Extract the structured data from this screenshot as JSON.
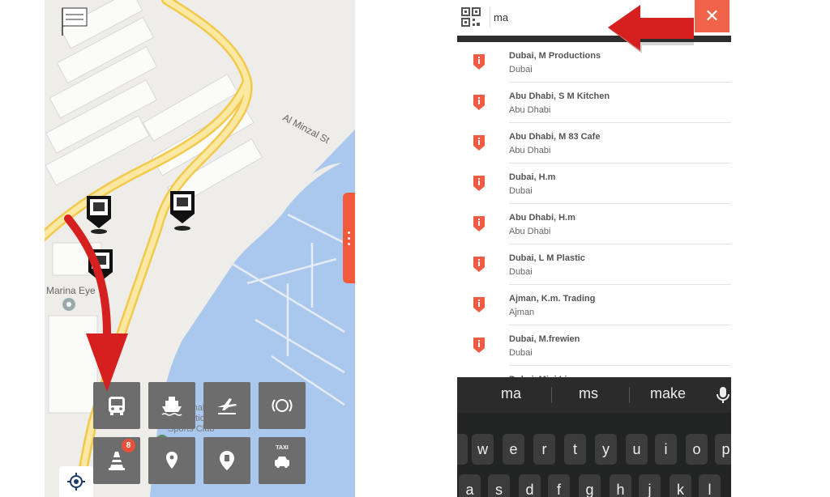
{
  "map": {
    "labels": {
      "street": "Al Minzal St",
      "marina_eye": "Marina Eye",
      "sports_club": "Abu Dhabi International Marine Sports Club"
    },
    "grid_buttons": [
      {
        "name": "bus-button",
        "icon": "bus-icon"
      },
      {
        "name": "ferry-button",
        "icon": "ferry-icon"
      },
      {
        "name": "airport-button",
        "icon": "airplane-icon"
      },
      {
        "name": "parking-button",
        "icon": "parking-signal-icon"
      },
      {
        "name": "road-works-button",
        "icon": "traffic-cone-icon",
        "badge": "8"
      },
      {
        "name": "place-pin-button",
        "icon": "location-pin-icon"
      },
      {
        "name": "fuel-pin-button",
        "icon": "fuel-pin-icon"
      },
      {
        "name": "taxi-button",
        "icon": "taxi-icon",
        "label": "TAXI"
      }
    ]
  },
  "search": {
    "query": "ma",
    "clear_label": "✕",
    "results": [
      {
        "title": "Dubai, M Productions",
        "subtitle": "Dubai"
      },
      {
        "title": "Abu Dhabi, S M Kitchen",
        "subtitle": "Abu Dhabi"
      },
      {
        "title": "Abu Dhabi, M 83 Cafe",
        "subtitle": "Abu Dhabi"
      },
      {
        "title": "Dubai, H.m",
        "subtitle": "Dubai"
      },
      {
        "title": "Abu Dhabi, H.m",
        "subtitle": "Abu Dhabi"
      },
      {
        "title": "Dubai, L M Plastic",
        "subtitle": "Dubai"
      },
      {
        "title": "Ajman, K.m. Trading",
        "subtitle": "Ajman"
      },
      {
        "title": "Dubai, M.frewien",
        "subtitle": "Dubai"
      },
      {
        "title": "Dubai, Mini Lion",
        "subtitle": ""
      }
    ]
  },
  "keyboard": {
    "suggestions": [
      "ma",
      "ms",
      "make"
    ],
    "row1": [
      "w",
      "e",
      "r",
      "t",
      "y",
      "u",
      "i",
      "o",
      "p"
    ],
    "row2": [
      "a",
      "s",
      "d",
      "f",
      "g",
      "h",
      "j",
      "k",
      "l"
    ]
  },
  "colors": {
    "accent": "#f0624a",
    "arrow": "#d61f1f",
    "water": "#aac8ee",
    "road": "#f7e08a"
  }
}
